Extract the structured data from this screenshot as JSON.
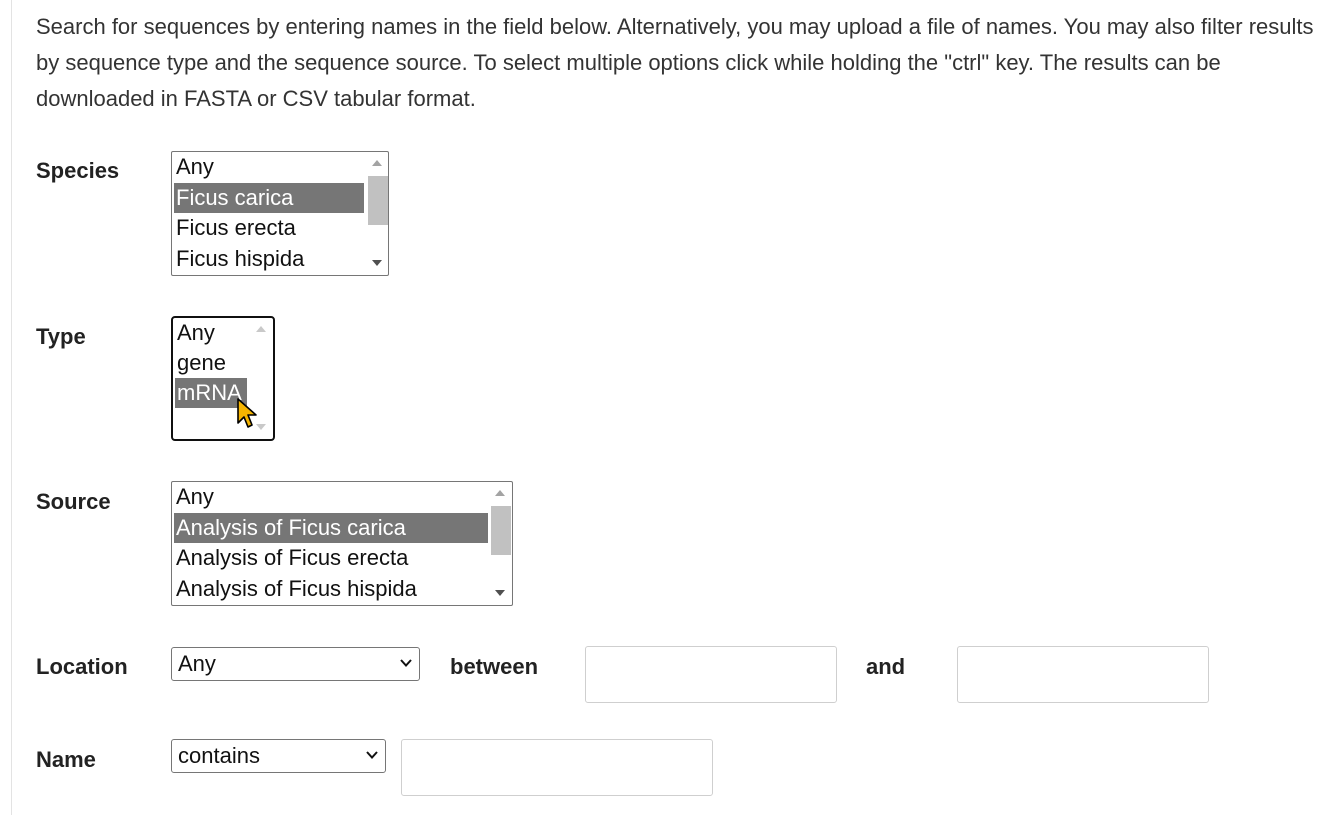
{
  "intro_text": "Search for sequences by entering names in the field below. Alternatively, you may upload a file of names. You may also filter results by sequence type and the sequence source. To select multiple options click while holding the \"ctrl\" key. The results can be downloaded in FASTA or CSV tabular format.",
  "species": {
    "label": "Species",
    "options": [
      "Any",
      "Ficus carica",
      "Ficus erecta",
      "Ficus hispida"
    ],
    "selected": "Ficus carica"
  },
  "type": {
    "label": "Type",
    "options": [
      "Any",
      "gene",
      "mRNA"
    ],
    "selected": "mRNA"
  },
  "source": {
    "label": "Source",
    "options": [
      "Any",
      "Analysis of Ficus carica",
      "Analysis of Ficus erecta",
      "Analysis of Ficus hispida"
    ],
    "selected": "Analysis of Ficus carica"
  },
  "location": {
    "label": "Location",
    "selected": "Any",
    "between_label": "between",
    "and_label": "and",
    "start_value": "",
    "end_value": ""
  },
  "name": {
    "label": "Name",
    "operator": "contains",
    "value": ""
  },
  "icons": {
    "scroll_up": "scroll-up-arrow-icon",
    "scroll_down": "scroll-down-arrow-icon",
    "dropdown": "chevron-down-icon",
    "cursor": "mouse-pointer-icon"
  },
  "colors": {
    "selected_option_bg": "#767676",
    "cursor_fill": "#f5b400"
  }
}
